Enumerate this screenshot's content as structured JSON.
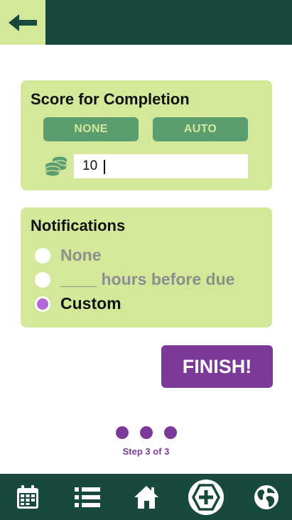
{
  "header": {
    "back_icon": "arrow-left-icon"
  },
  "score": {
    "title": "Score for Completion",
    "mode_none_label": "NONE",
    "mode_auto_label": "AUTO",
    "icon": "coins-stack-icon",
    "value": "10"
  },
  "notifications": {
    "title": "Notifications",
    "options": [
      {
        "label": "None",
        "selected": false
      },
      {
        "label": "____ hours before due",
        "selected": false
      },
      {
        "label": "Custom",
        "selected": true
      }
    ]
  },
  "finish_label": "FINISH!",
  "stepper": {
    "total": 3,
    "current": 3,
    "label": "Step 3 of 3"
  },
  "bottom_nav": {
    "items": [
      "calendar-icon",
      "list-icon",
      "home-icon",
      "add-icon",
      "globe-icon"
    ]
  },
  "colors": {
    "dark_green": "#174a3c",
    "card_green": "#d4e89a",
    "button_green": "#5a9e6f",
    "purple": "#7b3a98",
    "radio_purple": "#b469d6"
  }
}
